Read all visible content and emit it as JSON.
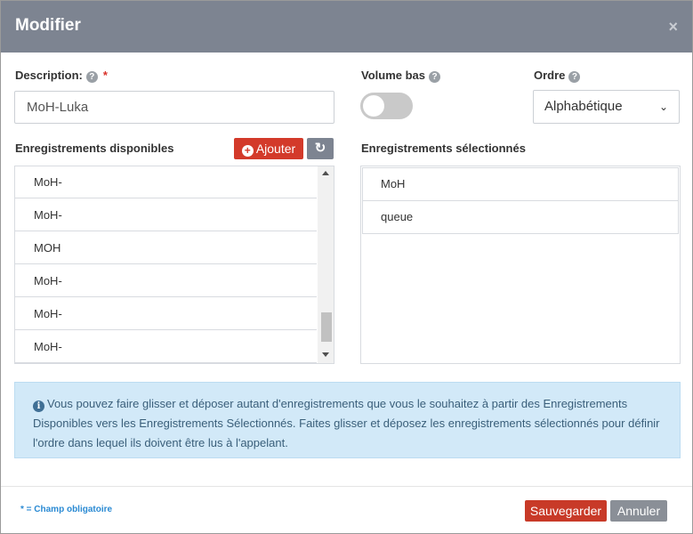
{
  "modal": {
    "title": "Modifier",
    "close_icon": "×"
  },
  "description": {
    "label": "Description:",
    "required_mark": "*",
    "help_icon": "?",
    "value": "MoH-Luka"
  },
  "volume_bas": {
    "label": "Volume bas",
    "help_icon": "?",
    "enabled": false
  },
  "ordre": {
    "label": "Ordre",
    "help_icon": "?",
    "selected": "Alphabétique",
    "chevron": "⌄"
  },
  "available": {
    "label": "Enregistrements disponibles",
    "add_label": "Ajouter",
    "add_icon": "+",
    "refresh_icon": "↻",
    "items": [
      "MoH-",
      "MoH-",
      "MOH",
      "MoH-",
      "MoH-",
      "MoH-"
    ]
  },
  "selected": {
    "label": "Enregistrements sélectionnés",
    "items": [
      "MoH",
      "queue"
    ]
  },
  "info": {
    "icon": "i",
    "text": "Vous pouvez faire glisser et déposer autant d'enregistrements que vous le souhaitez à partir des Enregistrements Disponibles vers les Enregistrements Sélectionnés. Faites glisser et déposez les enregistrements sélectionnés pour définir l'ordre dans lequel ils doivent être lus à l'appelant."
  },
  "footer": {
    "required_note": "* = Champ obligatoire",
    "save_label": "Sauvegarder",
    "cancel_label": "Annuler"
  },
  "colors": {
    "header": "#7d8491",
    "primary_button": "#d33a2a",
    "info_background": "#d2e9f8",
    "required_note": "#2a8ad3"
  }
}
